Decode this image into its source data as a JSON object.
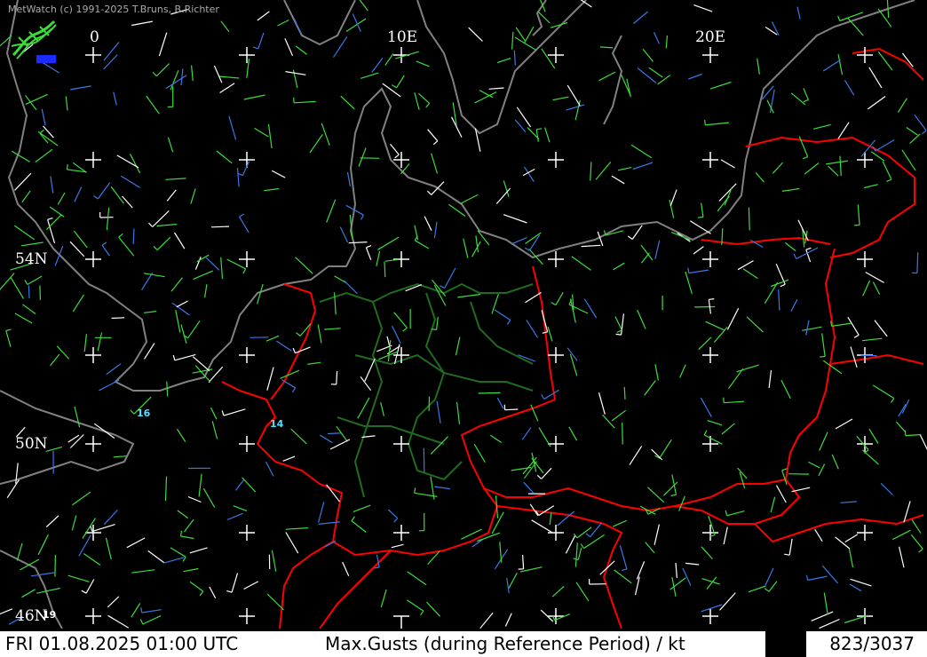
{
  "header": {
    "credit": "MetWatch  (c) 1991-2025 T.Bruns, B.Richter"
  },
  "logo": {
    "icon": "metwatch-logo-icon"
  },
  "grid_labels": {
    "lon_0": "0",
    "lon_10": "10E",
    "lon_20": "20E",
    "lat_54": "54N",
    "lat_50": "50N",
    "lat_46": "46N"
  },
  "gust_labels": [
    "16",
    "14",
    "19"
  ],
  "status_bar": {
    "datetime": "FRI 01.08.2025 01:00 UTC",
    "product": "Max.Gusts (during Reference Period) / kt",
    "station_count": "823/3037"
  },
  "colors": {
    "background": "#000000",
    "coastline": "#808080",
    "country_border": "#ff0000",
    "state_border": "#1f6b1f",
    "graticule": "#ffffff",
    "wind_light": "#3cdc3c",
    "wind_medium": "#3a78e8",
    "wind_strong": "#ffffff"
  }
}
